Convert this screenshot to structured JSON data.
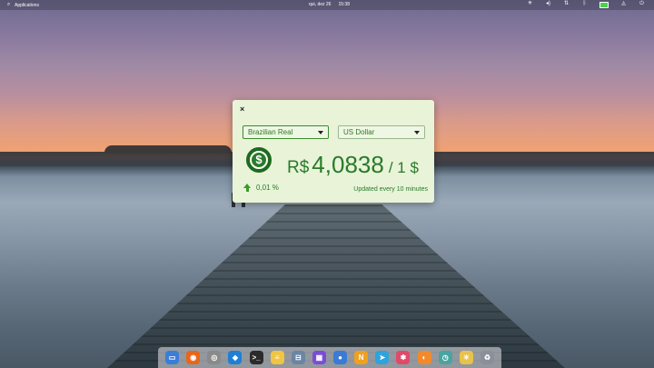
{
  "topbar": {
    "applications_label": "Applications",
    "date": "qui, dez 26",
    "time": "15:38",
    "tray_icons": [
      "brightness-icon",
      "volume-icon",
      "network-icon",
      "bluetooth-icon",
      "battery-icon",
      "notifications-icon",
      "power-icon"
    ]
  },
  "widget": {
    "close_glyph": "×",
    "from_currency": "Brazilian Real",
    "to_currency": "US Dollar",
    "rate_symbol": "R$",
    "rate_value": "4,0838",
    "rate_per": "/ 1 $",
    "change": "0,01 %",
    "update_text": "Updated every 10 minutes",
    "coin_glyph": "$"
  },
  "dock": {
    "apps": [
      {
        "name": "files-app-icon",
        "glyph": "▭",
        "color": "#3b7ed8"
      },
      {
        "name": "firefox-icon",
        "glyph": "◉",
        "color": "#e8661c"
      },
      {
        "name": "camera-icon",
        "glyph": "◎",
        "color": "#8a8a8a"
      },
      {
        "name": "vscode-icon",
        "glyph": "◆",
        "color": "#1f7fd4"
      },
      {
        "name": "terminal-icon",
        "glyph": ">_",
        "color": "#2b2b2b"
      },
      {
        "name": "notes-icon",
        "glyph": "≡",
        "color": "#f0c544"
      },
      {
        "name": "switchboard-icon",
        "glyph": "⊟",
        "color": "#6b85a3"
      },
      {
        "name": "calendar-icon",
        "glyph": "▦",
        "color": "#7a4dd6"
      },
      {
        "name": "web-browser-icon",
        "glyph": "●",
        "color": "#3a7bd5"
      },
      {
        "name": "app-n-icon",
        "glyph": "N",
        "color": "#f0a020"
      },
      {
        "name": "telegram-icon",
        "glyph": "➤",
        "color": "#2ea3dc"
      },
      {
        "name": "slack-icon",
        "glyph": "✱",
        "color": "#e04a6a"
      },
      {
        "name": "pidgin-icon",
        "glyph": "◐",
        "color": "#f28a2c"
      },
      {
        "name": "clock-icon",
        "glyph": "◷",
        "color": "#4aa3a0"
      },
      {
        "name": "weather-icon",
        "glyph": "☀",
        "color": "#e8c24a"
      },
      {
        "name": "trash-icon",
        "glyph": "♻",
        "color": "#8a9099"
      }
    ]
  }
}
